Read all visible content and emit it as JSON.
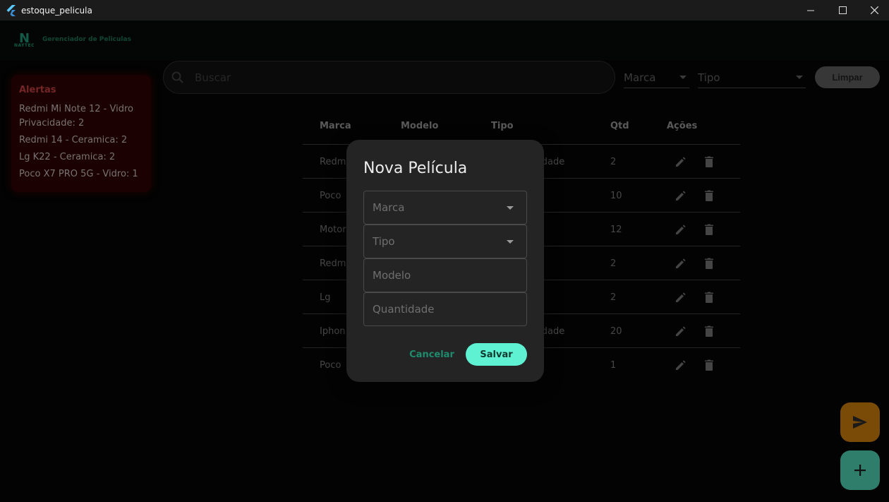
{
  "window": {
    "title": "estoque_pelicula"
  },
  "app": {
    "logo_letter": "N",
    "logo_sub": "NAYTEC",
    "name": "Gerenciador de Peliculas"
  },
  "alerts": {
    "heading": "Alertas",
    "items": [
      "Redmi Mi Note 12 - Vidro Privacidade: 2",
      "Redmi 14 - Ceramica: 2",
      "Lg K22 - Ceramica: 2",
      "Poco X7 PRO 5G - Vidro: 1"
    ]
  },
  "search": {
    "placeholder": "Buscar"
  },
  "filters": {
    "marca": "Marca",
    "tipo": "Tipo",
    "clear_label": "Limpar"
  },
  "table": {
    "headers": {
      "marca": "Marca",
      "modelo": "Modelo",
      "tipo": "Tipo",
      "qtd": "Qtd",
      "acoes": "Ações"
    },
    "rows": [
      {
        "marca": "Redmi",
        "tipo_tail": "cidade",
        "qtd": "2"
      },
      {
        "marca": "Poco",
        "tipo_tail": "",
        "qtd": "10"
      },
      {
        "marca": "Motor",
        "tipo_tail": "",
        "qtd": "12"
      },
      {
        "marca": "Redmi",
        "tipo_tail": "",
        "qtd": "2"
      },
      {
        "marca": "Lg",
        "tipo_tail": "",
        "qtd": "2"
      },
      {
        "marca": "Iphon",
        "tipo_tail": "cidade",
        "qtd": "20"
      },
      {
        "marca": "Poco",
        "tipo_tail": "",
        "qtd": "1"
      }
    ]
  },
  "dialog": {
    "title": "Nova Película",
    "fields": {
      "marca": "Marca",
      "tipo": "Tipo",
      "modelo": "Modelo",
      "quantidade": "Quantidade"
    },
    "cancel_label": "Cancelar",
    "save_label": "Salvar"
  },
  "colors": {
    "accent": "#5ef2d2",
    "alert": "#b33b3b",
    "send_fab": "#7a4a07",
    "add_fab": "#2f7d6b"
  }
}
